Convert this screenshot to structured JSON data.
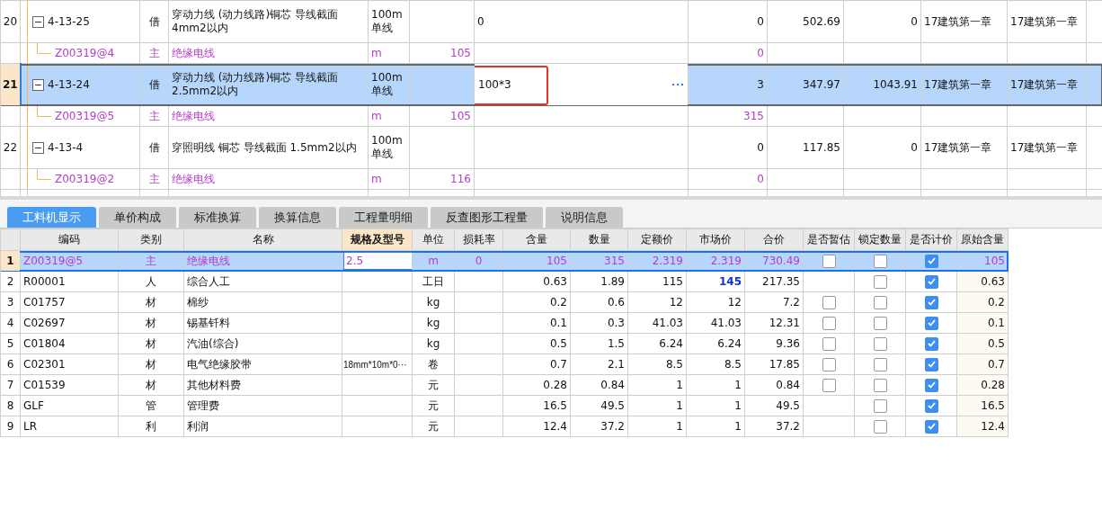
{
  "top": {
    "rows": [
      {
        "no": "20",
        "kind": "item",
        "selected": false,
        "expanded": true,
        "code": "4-13-25",
        "type": "借",
        "name": "穿动力线 (动力线路)铜芯 导线截面 4mm2以内",
        "unit": "100m单线",
        "expression": "0",
        "column_9": "0",
        "column_10": "502.69",
        "column_11": "0",
        "column_12": "17建筑第一章",
        "column_13": "17建筑第一章",
        "children": [
          {
            "kind": "resource",
            "selected": false,
            "code": "Z00319@4",
            "type": "主",
            "name": "绝缘电线",
            "unit": "m",
            "column_7": "105",
            "column_9": "0"
          }
        ]
      },
      {
        "no": "21",
        "kind": "item",
        "selected": true,
        "expanded": true,
        "editing": true,
        "highlighted": true,
        "code": "4-13-24",
        "type": "借",
        "name": "穿动力线 (动力线路)铜芯 导线截面 2.5mm2以内",
        "unit": "100m单线",
        "expression": "100*3",
        "column_9": "3",
        "column_10": "347.97",
        "column_11": "1043.91",
        "column_12": "17建筑第一章",
        "column_13": "17建筑第一章",
        "children": [
          {
            "kind": "resource",
            "selected": false,
            "code": "Z00319@5",
            "type": "主",
            "name": "绝缘电线",
            "unit": "m",
            "column_7": "105",
            "column_9": "315"
          }
        ]
      },
      {
        "no": "22",
        "kind": "item",
        "selected": false,
        "expanded": true,
        "code": "4-13-4",
        "type": "借",
        "name": "穿照明线 铜芯 导线截面 1.5mm2以内",
        "unit": "100m单线",
        "column_9": "0",
        "column_10": "117.85",
        "column_11": "0",
        "column_12": "17建筑第一章",
        "column_13": "17建筑第一章",
        "children": [
          {
            "kind": "resource",
            "selected": false,
            "code": "Z00319@2",
            "type": "主",
            "name": "绝缘电线",
            "unit": "m",
            "column_7": "116",
            "column_9": "0"
          }
        ]
      }
    ]
  },
  "tabs": [
    {
      "label": "工料机显示",
      "selected": true
    },
    {
      "label": "单价构成",
      "selected": false
    },
    {
      "label": "标准换算",
      "selected": false
    },
    {
      "label": "换算信息",
      "selected": false
    },
    {
      "label": "工程量明细",
      "selected": false
    },
    {
      "label": "反查图形工程量",
      "selected": false
    },
    {
      "label": "说明信息",
      "selected": false
    }
  ],
  "lower": {
    "columns": [
      {
        "label": "编码",
        "focused": false
      },
      {
        "label": "类别",
        "focused": false
      },
      {
        "label": "名称",
        "focused": false
      },
      {
        "label": "规格及型号",
        "focused": true
      },
      {
        "label": "单位",
        "focused": false
      },
      {
        "label": "损耗率",
        "focused": false
      },
      {
        "label": "含量",
        "focused": false
      },
      {
        "label": "数量",
        "focused": false
      },
      {
        "label": "定额价",
        "focused": false
      },
      {
        "label": "市场价",
        "focused": false
      },
      {
        "label": "合价",
        "focused": false
      },
      {
        "label": "是否暂估",
        "focused": false
      },
      {
        "label": "锁定数量",
        "focused": false
      },
      {
        "label": "是否计价",
        "focused": false
      },
      {
        "label": "原始含量",
        "focused": false
      }
    ],
    "rows": [
      {
        "no": "1",
        "kind": "main",
        "selected": true,
        "editing": true,
        "price_changed": false,
        "code": "Z00319@5",
        "type": "主",
        "name": "绝缘电线",
        "spec": "2.5",
        "unit": "m",
        "loss": "0",
        "content": "105",
        "quantity": "315",
        "quota_price": "2.319",
        "market_price": "2.319",
        "total": "730.49",
        "estimate": false,
        "locked": false,
        "priced": true,
        "original": "105"
      },
      {
        "no": "2",
        "kind": "normal",
        "selected": false,
        "editing": false,
        "price_changed": true,
        "code": "R00001",
        "type": "人",
        "name": "综合人工",
        "unit": "工日",
        "content": "0.63",
        "quantity": "1.89",
        "quota_price": "115",
        "market_price": "145",
        "total": "217.35",
        "locked": false,
        "priced": true,
        "original": "0.63"
      },
      {
        "no": "3",
        "kind": "normal",
        "selected": false,
        "editing": false,
        "price_changed": false,
        "code": "C01757",
        "type": "材",
        "name": "棉纱",
        "unit": "kg",
        "content": "0.2",
        "quantity": "0.6",
        "quota_price": "12",
        "market_price": "12",
        "total": "7.2",
        "estimate": false,
        "locked": false,
        "priced": true,
        "original": "0.2"
      },
      {
        "no": "4",
        "kind": "normal",
        "selected": false,
        "editing": false,
        "price_changed": false,
        "code": "C02697",
        "type": "材",
        "name": "锡基钎料",
        "unit": "kg",
        "content": "0.1",
        "quantity": "0.3",
        "quota_price": "41.03",
        "market_price": "41.03",
        "total": "12.31",
        "estimate": false,
        "locked": false,
        "priced": true,
        "original": "0.1"
      },
      {
        "no": "5",
        "kind": "normal",
        "selected": false,
        "editing": false,
        "price_changed": false,
        "code": "C01804",
        "type": "材",
        "name": "汽油(综合)",
        "unit": "kg",
        "content": "0.5",
        "quantity": "1.5",
        "quota_price": "6.24",
        "market_price": "6.24",
        "total": "9.36",
        "estimate": false,
        "locked": false,
        "priced": true,
        "original": "0.5"
      },
      {
        "no": "6",
        "kind": "normal",
        "selected": false,
        "editing": false,
        "price_changed": false,
        "code": "C02301",
        "type": "材",
        "name": "电气绝缘胶带",
        "spec": "18mm*10m*0···",
        "unit": "卷",
        "content": "0.7",
        "quantity": "2.1",
        "quota_price": "8.5",
        "market_price": "8.5",
        "total": "17.85",
        "estimate": false,
        "locked": false,
        "priced": true,
        "original": "0.7"
      },
      {
        "no": "7",
        "kind": "normal",
        "selected": false,
        "editing": false,
        "price_changed": false,
        "code": "C01539",
        "type": "材",
        "name": "其他材料费",
        "unit": "元",
        "content": "0.28",
        "quantity": "0.84",
        "quota_price": "1",
        "market_price": "1",
        "total": "0.84",
        "estimate": false,
        "locked": false,
        "priced": true,
        "original": "0.28"
      },
      {
        "no": "8",
        "kind": "normal",
        "selected": false,
        "editing": false,
        "price_changed": false,
        "code": "GLF",
        "type": "管",
        "name": "管理费",
        "unit": "元",
        "content": "16.5",
        "quantity": "49.5",
        "quota_price": "1",
        "market_price": "1",
        "total": "49.5",
        "locked": false,
        "priced": true,
        "original": "16.5"
      },
      {
        "no": "9",
        "kind": "normal",
        "selected": false,
        "editing": false,
        "price_changed": false,
        "code": "LR",
        "type": "利",
        "name": "利润",
        "unit": "元",
        "content": "12.4",
        "quantity": "37.2",
        "quota_price": "1",
        "market_price": "1",
        "total": "37.2",
        "locked": false,
        "priced": true,
        "original": "12.4"
      }
    ]
  }
}
